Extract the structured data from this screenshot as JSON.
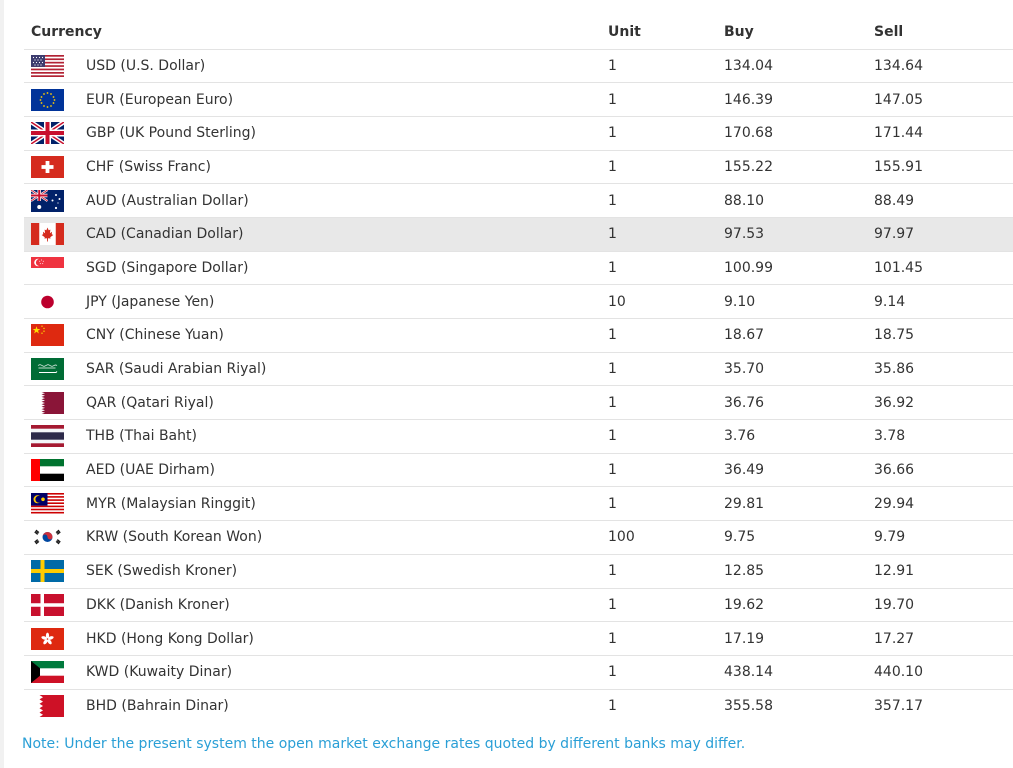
{
  "headers": {
    "currency": "Currency",
    "unit": "Unit",
    "buy": "Buy",
    "sell": "Sell"
  },
  "rows": [
    {
      "flag": "us-flag-icon",
      "name": "USD (U.S. Dollar)",
      "unit": "1",
      "buy": "134.04",
      "sell": "134.64"
    },
    {
      "flag": "eu-flag-icon",
      "name": "EUR (European Euro)",
      "unit": "1",
      "buy": "146.39",
      "sell": "147.05"
    },
    {
      "flag": "uk-flag-icon",
      "name": "GBP (UK Pound Sterling)",
      "unit": "1",
      "buy": "170.68",
      "sell": "171.44"
    },
    {
      "flag": "ch-flag-icon",
      "name": "CHF (Swiss Franc)",
      "unit": "1",
      "buy": "155.22",
      "sell": "155.91"
    },
    {
      "flag": "au-flag-icon",
      "name": "AUD (Australian Dollar)",
      "unit": "1",
      "buy": "88.10",
      "sell": "88.49"
    },
    {
      "flag": "ca-flag-icon",
      "name": "CAD (Canadian Dollar)",
      "unit": "1",
      "buy": "97.53",
      "sell": "97.97"
    },
    {
      "flag": "sg-flag-icon",
      "name": "SGD (Singapore Dollar)",
      "unit": "1",
      "buy": "100.99",
      "sell": "101.45"
    },
    {
      "flag": "jp-flag-icon",
      "name": "JPY (Japanese Yen)",
      "unit": "10",
      "buy": "9.10",
      "sell": "9.14"
    },
    {
      "flag": "cn-flag-icon",
      "name": "CNY (Chinese Yuan)",
      "unit": "1",
      "buy": "18.67",
      "sell": "18.75"
    },
    {
      "flag": "sa-flag-icon",
      "name": "SAR (Saudi Arabian Riyal)",
      "unit": "1",
      "buy": "35.70",
      "sell": "35.86"
    },
    {
      "flag": "qa-flag-icon",
      "name": "QAR (Qatari Riyal)",
      "unit": "1",
      "buy": "36.76",
      "sell": "36.92"
    },
    {
      "flag": "th-flag-icon",
      "name": "THB (Thai Baht)",
      "unit": "1",
      "buy": "3.76",
      "sell": "3.78"
    },
    {
      "flag": "ae-flag-icon",
      "name": "AED (UAE Dirham)",
      "unit": "1",
      "buy": "36.49",
      "sell": "36.66"
    },
    {
      "flag": "my-flag-icon",
      "name": "MYR (Malaysian Ringgit)",
      "unit": "1",
      "buy": "29.81",
      "sell": "29.94"
    },
    {
      "flag": "kr-flag-icon",
      "name": "KRW (South Korean Won)",
      "unit": "100",
      "buy": "9.75",
      "sell": "9.79"
    },
    {
      "flag": "se-flag-icon",
      "name": "SEK (Swedish Kroner)",
      "unit": "1",
      "buy": "12.85",
      "sell": "12.91"
    },
    {
      "flag": "dk-flag-icon",
      "name": "DKK (Danish Kroner)",
      "unit": "1",
      "buy": "19.62",
      "sell": "19.70"
    },
    {
      "flag": "hk-flag-icon",
      "name": "HKD (Hong Kong Dollar)",
      "unit": "1",
      "buy": "17.19",
      "sell": "17.27"
    },
    {
      "flag": "kw-flag-icon",
      "name": "KWD (Kuwaity Dinar)",
      "unit": "1",
      "buy": "438.14",
      "sell": "440.10"
    },
    {
      "flag": "bh-flag-icon",
      "name": "BHD (Bahrain Dinar)",
      "unit": "1",
      "buy": "355.58",
      "sell": "357.17"
    }
  ],
  "highlighted_row": 5,
  "note": "Note: Under the present system the open market exchange rates quoted by different banks may differ.",
  "colors": {
    "note": "#2a9fd6",
    "row_border": "#e3e3e3",
    "highlight": "#e8e8e8"
  }
}
